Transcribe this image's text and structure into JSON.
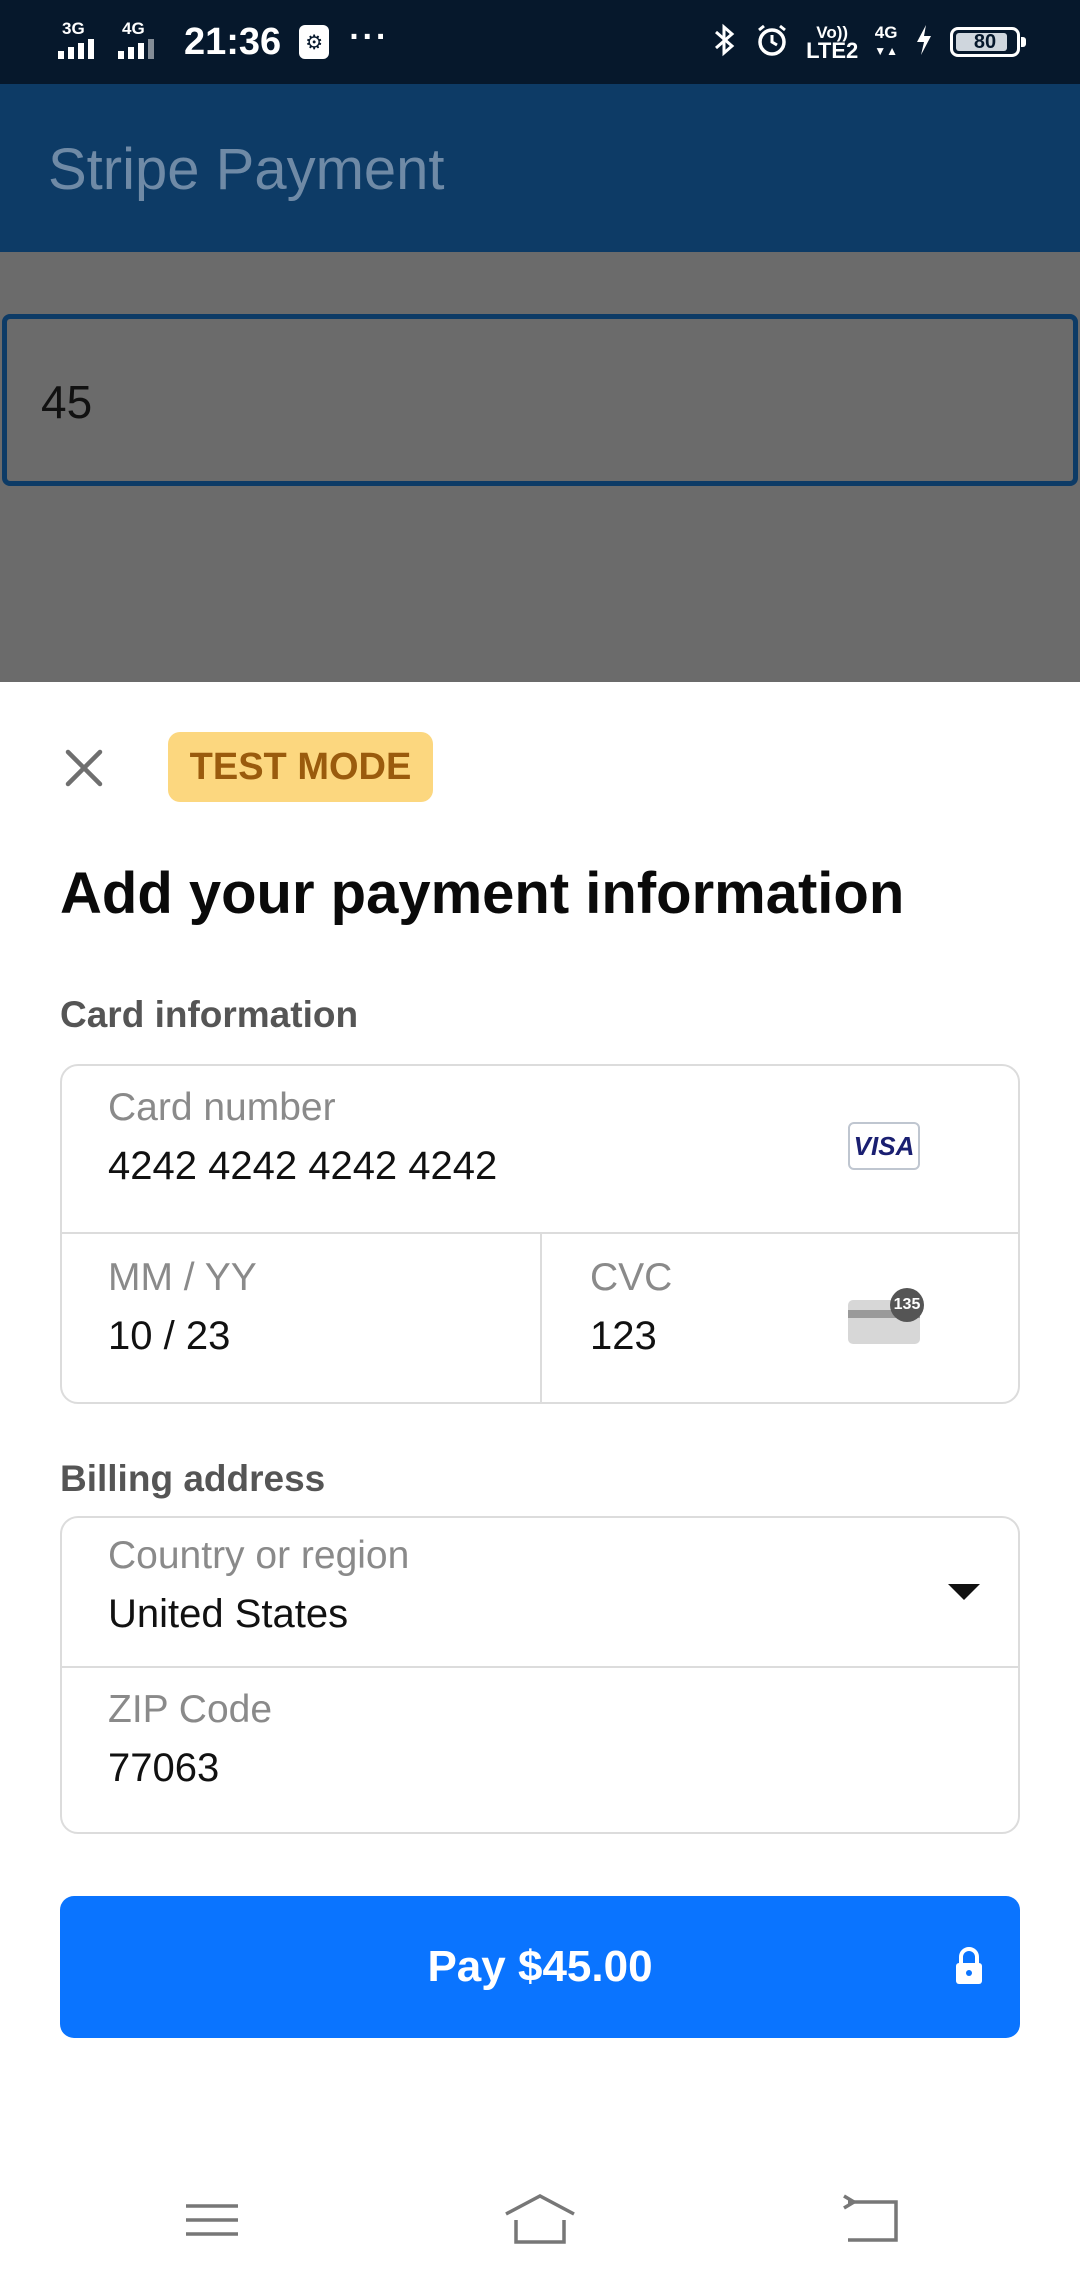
{
  "status_bar": {
    "network_1": "3G",
    "network_2": "4G",
    "time": "21:36",
    "usb_glyph": "⚙",
    "more": "···",
    "volte_top": "Vo))",
    "volte_bottom": "LTE2",
    "network_right": "4G",
    "battery": "80"
  },
  "app_bar": {
    "title": "Stripe Payment"
  },
  "amount_input": {
    "value": "45"
  },
  "sheet": {
    "test_mode": "TEST MODE",
    "title": "Add your payment information",
    "card_section_label": "Card information",
    "card_number_label": "Card number",
    "card_number_value": "4242 4242 4242 4242",
    "card_brand": "VISA",
    "expiry_label": "MM / YY",
    "expiry_value": "10 / 23",
    "cvc_label": "CVC",
    "cvc_value": "123",
    "cvc_hint": "135",
    "billing_section_label": "Billing address",
    "country_label": "Country or region",
    "country_value": "United States",
    "zip_label": "ZIP Code",
    "zip_value": "77063",
    "pay_button": "Pay $45.00"
  },
  "colors": {
    "status_bar": "#06182c",
    "app_bar": "#0d3b66",
    "pay_button": "#0a74ff",
    "test_badge": "#fcd77f"
  },
  "icons": [
    "close-icon",
    "visa-icon",
    "cvc-icon",
    "chevron-down-icon",
    "lock-icon",
    "menu-icon",
    "home-icon",
    "back-icon"
  ]
}
